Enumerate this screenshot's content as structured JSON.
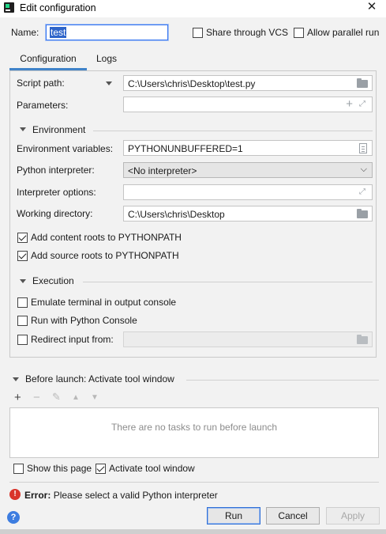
{
  "window": {
    "title": "Edit configuration",
    "close_glyph": "✕"
  },
  "header": {
    "name_label": "Name:",
    "name_value": "test",
    "share_vcs_label": "Share through VCS",
    "share_vcs_checked": false,
    "allow_parallel_label": "Allow parallel run",
    "allow_parallel_checked": false
  },
  "tabs": [
    {
      "label": "Configuration",
      "active": true
    },
    {
      "label": "Logs",
      "active": false
    }
  ],
  "config": {
    "script_path_label": "Script path:",
    "script_path_value": "C:\\Users\\chris\\Desktop\\test.py",
    "parameters_label": "Parameters:",
    "parameters_value": "",
    "environment_section": "Environment",
    "env_vars_label": "Environment variables:",
    "env_vars_value": "PYTHONUNBUFFERED=1",
    "interpreter_label": "Python interpreter:",
    "interpreter_value": "<No interpreter>",
    "interpreter_options_label": "Interpreter options:",
    "interpreter_options_value": "",
    "working_dir_label": "Working directory:",
    "working_dir_value": "C:\\Users\\chris\\Desktop",
    "add_content_roots_label": "Add content roots to PYTHONPATH",
    "add_content_roots_checked": true,
    "add_source_roots_label": "Add source roots to PYTHONPATH",
    "add_source_roots_checked": true,
    "execution_section": "Execution",
    "emulate_terminal_label": "Emulate terminal in output console",
    "emulate_terminal_checked": false,
    "run_python_console_label": "Run with Python Console",
    "run_python_console_checked": false,
    "redirect_input_label": "Redirect input from:",
    "redirect_input_checked": false,
    "redirect_input_value": ""
  },
  "before_launch": {
    "title": "Before launch: Activate tool window",
    "empty_text": "There are no tasks to run before launch",
    "show_page_label": "Show this page",
    "show_page_checked": false,
    "activate_tool_label": "Activate tool window",
    "activate_tool_checked": true
  },
  "error": {
    "prefix": "Error:",
    "message": "Please select a valid Python interpreter"
  },
  "buttons": {
    "run": "Run",
    "cancel": "Cancel",
    "apply": "Apply"
  },
  "icons": {
    "help": "?",
    "error": "!",
    "plus": "+",
    "minus": "−",
    "edit": "✎",
    "up": "▲",
    "down": "▼",
    "expand": "⤢"
  },
  "colors": {
    "accent": "#4083c9",
    "error": "#d9342b",
    "help": "#3d7de0",
    "selection": "#2f65ca"
  }
}
